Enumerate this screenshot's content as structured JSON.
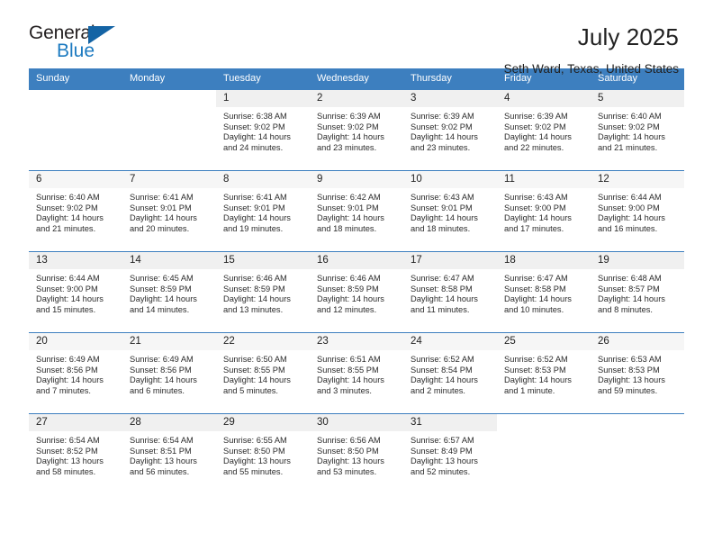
{
  "logo": {
    "word_top": "General",
    "word_bottom": "Blue",
    "icon": "triangle-icon",
    "accent_color": "#1c7ac0"
  },
  "header": {
    "title": "July 2025",
    "subtitle": "Seth Ward, Texas, United States"
  },
  "colors": {
    "header_blue": "#3d7fbf",
    "daynum_band": "#f0f0f0",
    "text": "#222222"
  },
  "weekdays": [
    "Sunday",
    "Monday",
    "Tuesday",
    "Wednesday",
    "Thursday",
    "Friday",
    "Saturday"
  ],
  "weeks": [
    [
      {
        "day": "",
        "sunrise": "",
        "sunset": "",
        "daylight1": "",
        "daylight2": ""
      },
      {
        "day": "",
        "sunrise": "",
        "sunset": "",
        "daylight1": "",
        "daylight2": ""
      },
      {
        "day": "1",
        "sunrise": "Sunrise: 6:38 AM",
        "sunset": "Sunset: 9:02 PM",
        "daylight1": "Daylight: 14 hours",
        "daylight2": "and 24 minutes."
      },
      {
        "day": "2",
        "sunrise": "Sunrise: 6:39 AM",
        "sunset": "Sunset: 9:02 PM",
        "daylight1": "Daylight: 14 hours",
        "daylight2": "and 23 minutes."
      },
      {
        "day": "3",
        "sunrise": "Sunrise: 6:39 AM",
        "sunset": "Sunset: 9:02 PM",
        "daylight1": "Daylight: 14 hours",
        "daylight2": "and 23 minutes."
      },
      {
        "day": "4",
        "sunrise": "Sunrise: 6:39 AM",
        "sunset": "Sunset: 9:02 PM",
        "daylight1": "Daylight: 14 hours",
        "daylight2": "and 22 minutes."
      },
      {
        "day": "5",
        "sunrise": "Sunrise: 6:40 AM",
        "sunset": "Sunset: 9:02 PM",
        "daylight1": "Daylight: 14 hours",
        "daylight2": "and 21 minutes."
      }
    ],
    [
      {
        "day": "6",
        "sunrise": "Sunrise: 6:40 AM",
        "sunset": "Sunset: 9:02 PM",
        "daylight1": "Daylight: 14 hours",
        "daylight2": "and 21 minutes."
      },
      {
        "day": "7",
        "sunrise": "Sunrise: 6:41 AM",
        "sunset": "Sunset: 9:01 PM",
        "daylight1": "Daylight: 14 hours",
        "daylight2": "and 20 minutes."
      },
      {
        "day": "8",
        "sunrise": "Sunrise: 6:41 AM",
        "sunset": "Sunset: 9:01 PM",
        "daylight1": "Daylight: 14 hours",
        "daylight2": "and 19 minutes."
      },
      {
        "day": "9",
        "sunrise": "Sunrise: 6:42 AM",
        "sunset": "Sunset: 9:01 PM",
        "daylight1": "Daylight: 14 hours",
        "daylight2": "and 18 minutes."
      },
      {
        "day": "10",
        "sunrise": "Sunrise: 6:43 AM",
        "sunset": "Sunset: 9:01 PM",
        "daylight1": "Daylight: 14 hours",
        "daylight2": "and 18 minutes."
      },
      {
        "day": "11",
        "sunrise": "Sunrise: 6:43 AM",
        "sunset": "Sunset: 9:00 PM",
        "daylight1": "Daylight: 14 hours",
        "daylight2": "and 17 minutes."
      },
      {
        "day": "12",
        "sunrise": "Sunrise: 6:44 AM",
        "sunset": "Sunset: 9:00 PM",
        "daylight1": "Daylight: 14 hours",
        "daylight2": "and 16 minutes."
      }
    ],
    [
      {
        "day": "13",
        "sunrise": "Sunrise: 6:44 AM",
        "sunset": "Sunset: 9:00 PM",
        "daylight1": "Daylight: 14 hours",
        "daylight2": "and 15 minutes."
      },
      {
        "day": "14",
        "sunrise": "Sunrise: 6:45 AM",
        "sunset": "Sunset: 8:59 PM",
        "daylight1": "Daylight: 14 hours",
        "daylight2": "and 14 minutes."
      },
      {
        "day": "15",
        "sunrise": "Sunrise: 6:46 AM",
        "sunset": "Sunset: 8:59 PM",
        "daylight1": "Daylight: 14 hours",
        "daylight2": "and 13 minutes."
      },
      {
        "day": "16",
        "sunrise": "Sunrise: 6:46 AM",
        "sunset": "Sunset: 8:59 PM",
        "daylight1": "Daylight: 14 hours",
        "daylight2": "and 12 minutes."
      },
      {
        "day": "17",
        "sunrise": "Sunrise: 6:47 AM",
        "sunset": "Sunset: 8:58 PM",
        "daylight1": "Daylight: 14 hours",
        "daylight2": "and 11 minutes."
      },
      {
        "day": "18",
        "sunrise": "Sunrise: 6:47 AM",
        "sunset": "Sunset: 8:58 PM",
        "daylight1": "Daylight: 14 hours",
        "daylight2": "and 10 minutes."
      },
      {
        "day": "19",
        "sunrise": "Sunrise: 6:48 AM",
        "sunset": "Sunset: 8:57 PM",
        "daylight1": "Daylight: 14 hours",
        "daylight2": "and 8 minutes."
      }
    ],
    [
      {
        "day": "20",
        "sunrise": "Sunrise: 6:49 AM",
        "sunset": "Sunset: 8:56 PM",
        "daylight1": "Daylight: 14 hours",
        "daylight2": "and 7 minutes."
      },
      {
        "day": "21",
        "sunrise": "Sunrise: 6:49 AM",
        "sunset": "Sunset: 8:56 PM",
        "daylight1": "Daylight: 14 hours",
        "daylight2": "and 6 minutes."
      },
      {
        "day": "22",
        "sunrise": "Sunrise: 6:50 AM",
        "sunset": "Sunset: 8:55 PM",
        "daylight1": "Daylight: 14 hours",
        "daylight2": "and 5 minutes."
      },
      {
        "day": "23",
        "sunrise": "Sunrise: 6:51 AM",
        "sunset": "Sunset: 8:55 PM",
        "daylight1": "Daylight: 14 hours",
        "daylight2": "and 3 minutes."
      },
      {
        "day": "24",
        "sunrise": "Sunrise: 6:52 AM",
        "sunset": "Sunset: 8:54 PM",
        "daylight1": "Daylight: 14 hours",
        "daylight2": "and 2 minutes."
      },
      {
        "day": "25",
        "sunrise": "Sunrise: 6:52 AM",
        "sunset": "Sunset: 8:53 PM",
        "daylight1": "Daylight: 14 hours",
        "daylight2": "and 1 minute."
      },
      {
        "day": "26",
        "sunrise": "Sunrise: 6:53 AM",
        "sunset": "Sunset: 8:53 PM",
        "daylight1": "Daylight: 13 hours",
        "daylight2": "and 59 minutes."
      }
    ],
    [
      {
        "day": "27",
        "sunrise": "Sunrise: 6:54 AM",
        "sunset": "Sunset: 8:52 PM",
        "daylight1": "Daylight: 13 hours",
        "daylight2": "and 58 minutes."
      },
      {
        "day": "28",
        "sunrise": "Sunrise: 6:54 AM",
        "sunset": "Sunset: 8:51 PM",
        "daylight1": "Daylight: 13 hours",
        "daylight2": "and 56 minutes."
      },
      {
        "day": "29",
        "sunrise": "Sunrise: 6:55 AM",
        "sunset": "Sunset: 8:50 PM",
        "daylight1": "Daylight: 13 hours",
        "daylight2": "and 55 minutes."
      },
      {
        "day": "30",
        "sunrise": "Sunrise: 6:56 AM",
        "sunset": "Sunset: 8:50 PM",
        "daylight1": "Daylight: 13 hours",
        "daylight2": "and 53 minutes."
      },
      {
        "day": "31",
        "sunrise": "Sunrise: 6:57 AM",
        "sunset": "Sunset: 8:49 PM",
        "daylight1": "Daylight: 13 hours",
        "daylight2": "and 52 minutes."
      },
      {
        "day": "",
        "sunrise": "",
        "sunset": "",
        "daylight1": "",
        "daylight2": ""
      },
      {
        "day": "",
        "sunrise": "",
        "sunset": "",
        "daylight1": "",
        "daylight2": ""
      }
    ]
  ]
}
